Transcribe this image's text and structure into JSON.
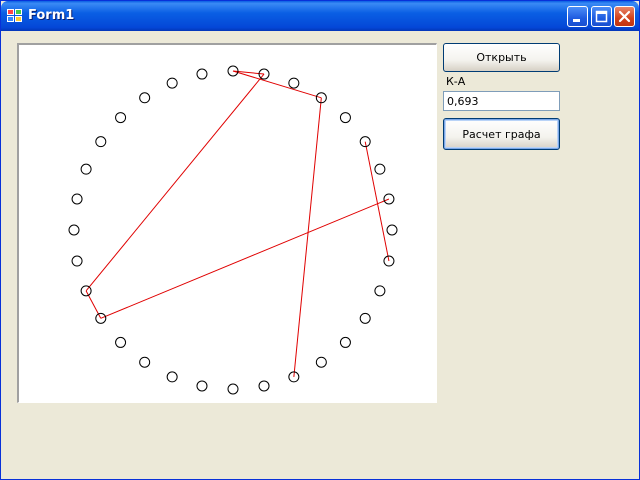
{
  "window": {
    "title": "Form1",
    "icon": "app-icon",
    "controls": [
      "minimize-icon",
      "maximize-icon",
      "close-icon"
    ]
  },
  "toolbar": {
    "open_label": "Открыть",
    "ka_label": "К-А",
    "ka_value": "0,693",
    "calc_label": "Расчет графа"
  },
  "graph": {
    "node_color": "#000000",
    "edge_color": "#E00000",
    "node_count": 32,
    "edges": [
      [
        2,
        3
      ],
      [
        2,
        5
      ],
      [
        3,
        24
      ],
      [
        5,
        16
      ],
      [
        7,
        11
      ],
      [
        9,
        23
      ],
      [
        23,
        24
      ]
    ]
  }
}
